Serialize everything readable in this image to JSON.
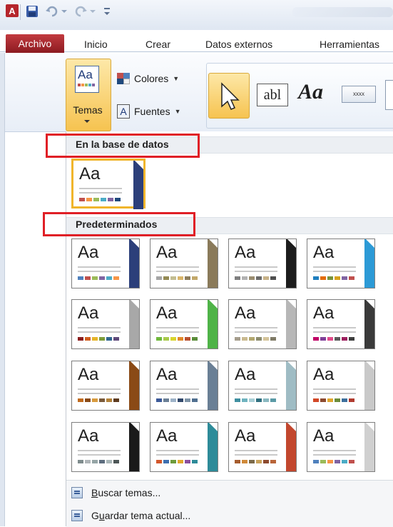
{
  "window": {
    "app_badge": "A"
  },
  "tabs": {
    "file": "Archivo",
    "items": [
      "Inicio",
      "Crear",
      "Datos externos",
      "Herramientas"
    ]
  },
  "ribbon": {
    "themes_label": "Temas",
    "colors_label": "Colores",
    "fonts_label": "Fuentes",
    "textbox_label": "abl",
    "label_control": "Aa",
    "button_control": "xxxx"
  },
  "gallery": {
    "section_db": "En la base de datos",
    "section_default": "Predeterminados",
    "current_theme": {
      "aa": "Aa",
      "accent": "#2c3f7a",
      "colors": [
        "#c0504d",
        "#f79646",
        "#9bbb59",
        "#4bacc6",
        "#8064a2",
        "#1f497d"
      ]
    },
    "themes": [
      {
        "aa": "Aa",
        "accent": "#2c3f7a",
        "colors": [
          "#4f81bd",
          "#c0504d",
          "#9bbb59",
          "#8064a2",
          "#4bacc6",
          "#f79646"
        ]
      },
      {
        "aa": "Aa",
        "accent": "#8a7a5a",
        "colors": [
          "#a5a5a5",
          "#948a54",
          "#c3bd92",
          "#d9b56b",
          "#8d7e5d",
          "#c2a86b"
        ]
      },
      {
        "aa": "Aa",
        "accent": "#1c1c1c",
        "colors": [
          "#7f7f7f",
          "#b2b2b2",
          "#9a8d70",
          "#6a6a6a",
          "#c7b288",
          "#4f4f4f"
        ]
      },
      {
        "aa": "Aa",
        "accent": "#2c9ad6",
        "colors": [
          "#1f7fbf",
          "#e36c09",
          "#77933c",
          "#d6a21d",
          "#8064a2",
          "#c0504d"
        ]
      },
      {
        "aa": "Aa",
        "accent": "#a8a8a8",
        "colors": [
          "#8b1d1d",
          "#d25f1e",
          "#e5b52a",
          "#7c9c3a",
          "#2f6690",
          "#5f497a"
        ]
      },
      {
        "aa": "Aa",
        "accent": "#4fb348",
        "colors": [
          "#6fb83b",
          "#a8c94a",
          "#d8d42c",
          "#e1892a",
          "#b85030",
          "#5a8d3a"
        ]
      },
      {
        "aa": "Aa",
        "accent": "#b7b7b7",
        "colors": [
          "#a59d8c",
          "#c9b98f",
          "#b2a76f",
          "#8c8c6e",
          "#d4c49a",
          "#7f7a66"
        ]
      },
      {
        "aa": "Aa",
        "accent": "#3a3a3a",
        "colors": [
          "#c00066",
          "#7f3f98",
          "#e04a8a",
          "#5a5a5a",
          "#9c1f5e",
          "#3d3d3d"
        ]
      },
      {
        "aa": "Aa",
        "accent": "#8a4a16",
        "colors": [
          "#c06a1c",
          "#8a4a16",
          "#d79a3d",
          "#7a5a3a",
          "#b3823a",
          "#5c3a1e"
        ]
      },
      {
        "aa": "Aa",
        "accent": "#6a7f95",
        "colors": [
          "#3b5998",
          "#6a7f95",
          "#9eb3c8",
          "#31486b",
          "#7f94a8",
          "#4f6f8f"
        ]
      },
      {
        "aa": "Aa",
        "accent": "#9fbcc4",
        "colors": [
          "#3f8fa0",
          "#6fb3bf",
          "#a9cfd6",
          "#2f6f7f",
          "#89b8c0",
          "#5a9aa6"
        ]
      },
      {
        "aa": "Aa",
        "accent": "#c9c9c9",
        "colors": [
          "#d24726",
          "#8c4a2f",
          "#e0a62e",
          "#6b8c3a",
          "#3d6f9c",
          "#b03a2e"
        ]
      },
      {
        "aa": "Aa",
        "accent": "#1a1a1a",
        "colors": [
          "#7f8c8d",
          "#b0b6b9",
          "#95a5a6",
          "#5d6d7e",
          "#aab7b8",
          "#4d5656"
        ]
      },
      {
        "aa": "Aa",
        "accent": "#2e8b99",
        "colors": [
          "#d3572b",
          "#3e6fb0",
          "#6e9b3b",
          "#e2a82e",
          "#8a4f9e",
          "#2e8b99"
        ]
      },
      {
        "aa": "Aa",
        "accent": "#c2472e",
        "colors": [
          "#a65d2e",
          "#d08a3a",
          "#7b6a4a",
          "#c9a25a",
          "#8c4a2e",
          "#b9653a"
        ]
      },
      {
        "aa": "Aa",
        "accent": "#d0d0d0",
        "colors": [
          "#4f81bd",
          "#9bbb59",
          "#f79646",
          "#8064a2",
          "#4bacc6",
          "#c0504d"
        ]
      }
    ],
    "footer": {
      "browse_prefix": "",
      "browse_underline": "B",
      "browse_rest": "uscar temas...",
      "save_prefix": "G",
      "save_underline": "u",
      "save_rest": "ardar tema actual..."
    }
  }
}
